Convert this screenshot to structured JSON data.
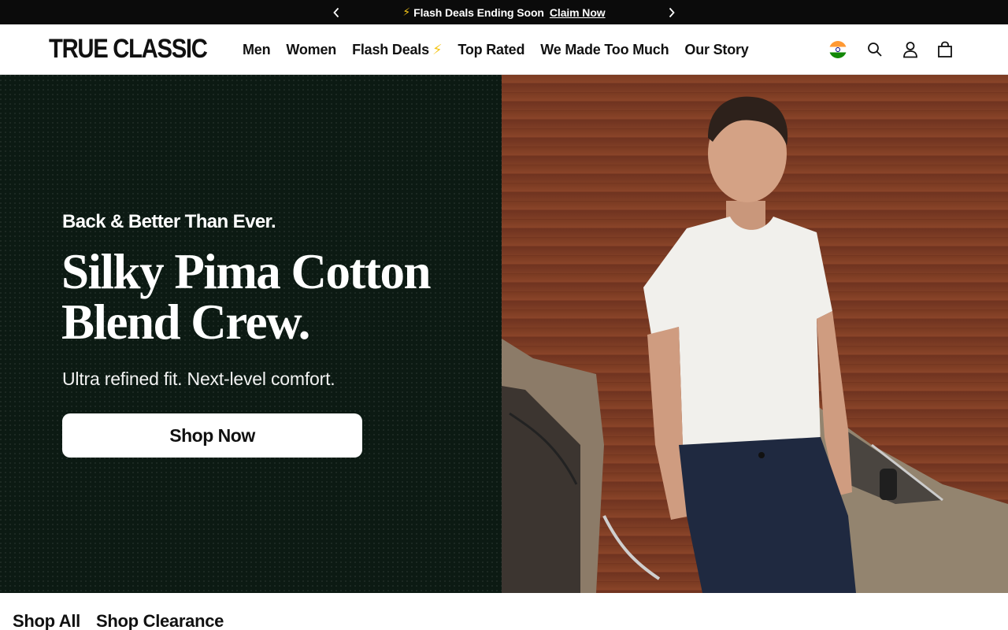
{
  "announcement": {
    "bolt": "⚡",
    "text": "Flash Deals Ending Soon",
    "link": "Claim Now"
  },
  "header": {
    "logo": "TRUE CLASSIC",
    "nav": [
      {
        "label": "Men"
      },
      {
        "label": "Women"
      },
      {
        "label": "Flash Deals",
        "badge": "⚡"
      },
      {
        "label": "Top Rated"
      },
      {
        "label": "We Made Too Much"
      },
      {
        "label": "Our Story"
      }
    ],
    "icons": [
      "india-flag-icon",
      "search-icon",
      "account-icon",
      "cart-icon"
    ]
  },
  "hero": {
    "eyebrow": "Back & Better Than Ever.",
    "headline_line1": "Silky Pima Cotton",
    "headline_line2": "Blend Crew.",
    "subhead": "Ultra refined fit. Next-level comfort.",
    "cta": "Shop Now"
  },
  "bottom_links": [
    {
      "label": "Shop All"
    },
    {
      "label": "Shop Clearance"
    }
  ],
  "colors": {
    "announcement_bg": "#0b0b0b",
    "hero_left_bg": "#0c1a13",
    "accent_bolt": "#f5c518"
  }
}
